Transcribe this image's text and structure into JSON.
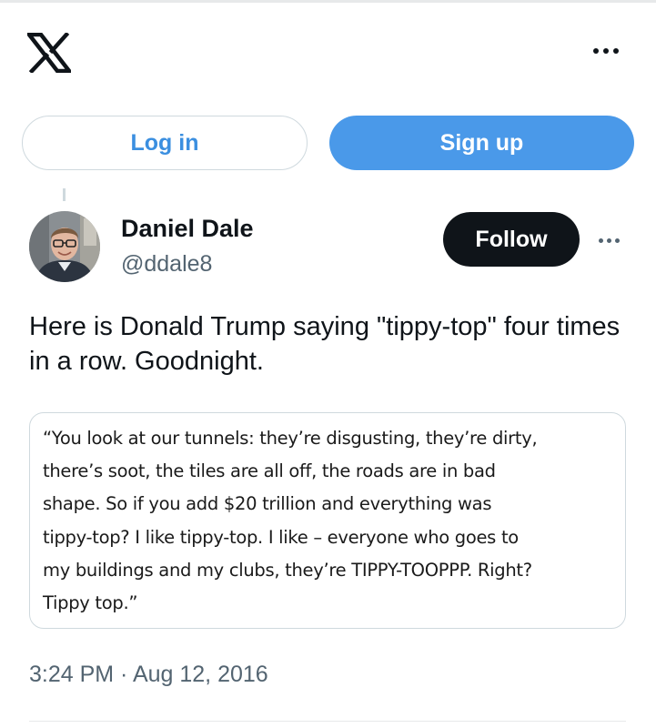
{
  "header": {
    "logo_icon": "x-logo-icon",
    "more_icon": "more-horizontal-icon"
  },
  "auth": {
    "login_label": "Log in",
    "signup_label": "Sign up"
  },
  "tweet": {
    "author": {
      "name": "Daniel Dale",
      "handle": "@ddale8",
      "avatar_icon": "avatar-photo"
    },
    "follow_label": "Follow",
    "more_icon": "more-horizontal-icon",
    "text": "Here is Donald Trump saying \"tippy-top\" four times in a row. Goodnight.",
    "quote_image_lines": [
      "“You look at our tunnels: they’re disgusting, they’re dirty,",
      "there’s soot, the tiles are all off, the roads are in bad",
      "shape. So if you add $20 trillion and everything was",
      "tippy-top? I like tippy-top. I like – everyone who goes to",
      "my buildings and my clubs, they’re TIPPY-TOOPPP.  Right?",
      "Tippy top.”"
    ],
    "timestamp": "3:24 PM · Aug 12, 2016"
  },
  "colors": {
    "accent": "#1d9bf0",
    "signup_bg": "#4a99e9",
    "follow_bg": "#0f1419",
    "secondary_text": "#536471",
    "border": "#cfd9de"
  }
}
